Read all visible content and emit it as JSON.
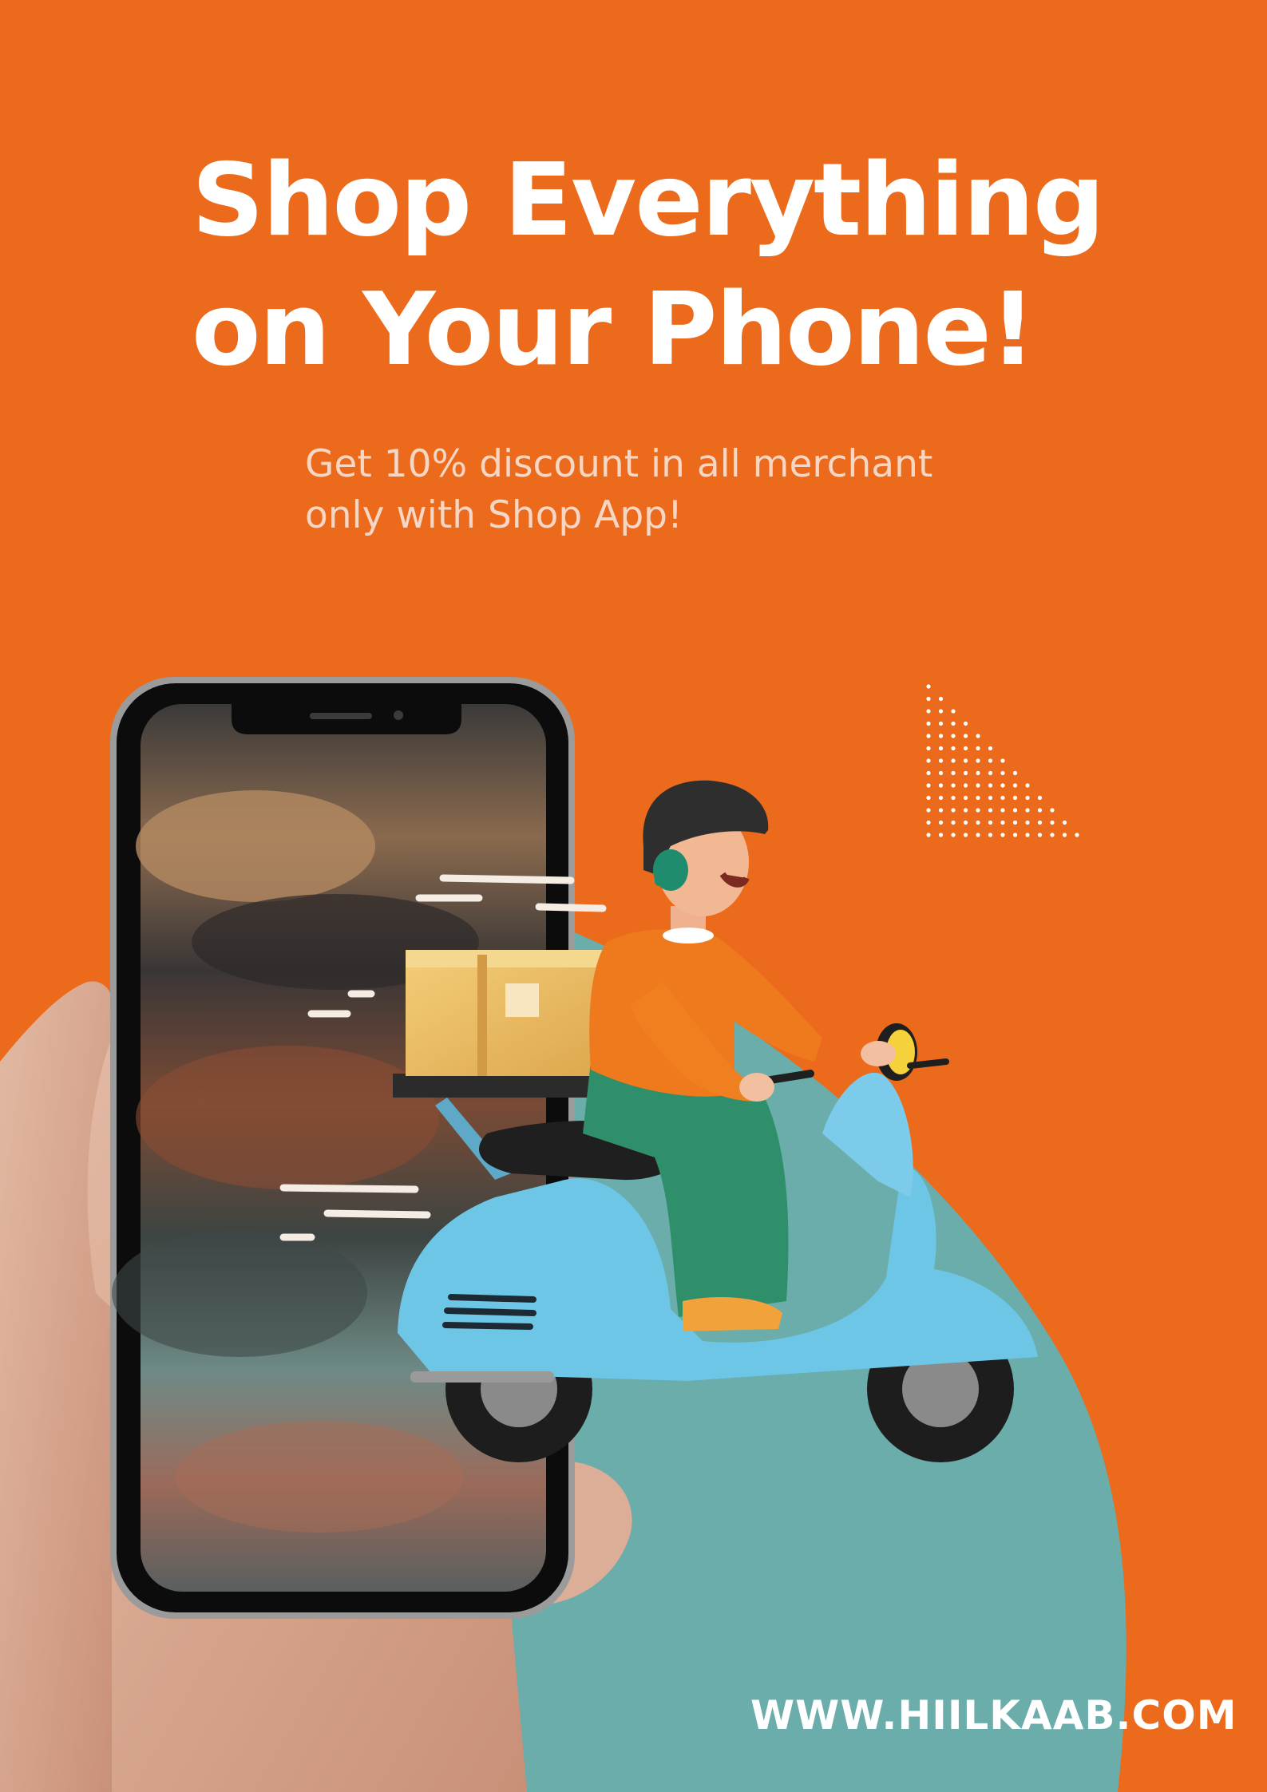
{
  "headline": {
    "line1": "Shop Everything",
    "line2": "on Your Phone!"
  },
  "subtext": {
    "line1": "Get 10% discount in all merchant",
    "line2": "only with Shop App!"
  },
  "website": "WWW.HIILKAAB.COM",
  "colors": {
    "background": "#ec6a1b",
    "teal_shape": "#6aadab",
    "scooter": "#6ec6e6",
    "headline_text": "#ffffff",
    "subtext": "#f6d6c4"
  },
  "illustrations": [
    "hand-holding-phone",
    "phone-screen-shoes-photo",
    "delivery-rider-on-scooter",
    "package-box",
    "dot-triangle-pattern"
  ]
}
